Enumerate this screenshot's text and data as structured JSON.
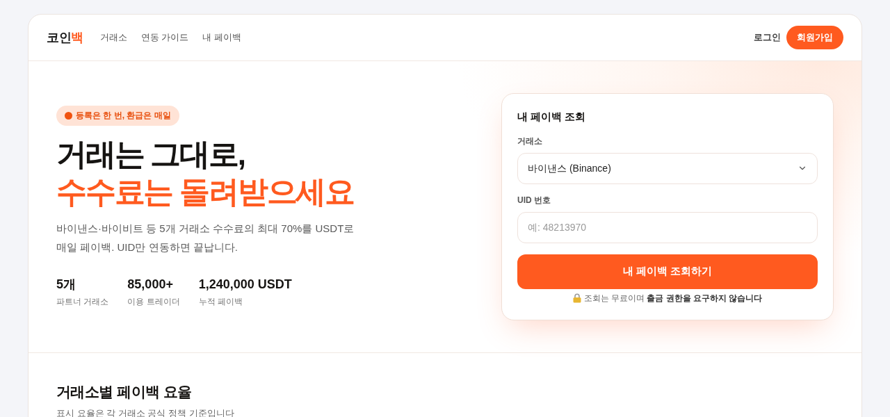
{
  "header": {
    "logo": {
      "text": "코인",
      "accent": "백"
    },
    "nav": [
      "거래소",
      "연동 가이드",
      "내 페이백"
    ],
    "login": "로그인",
    "signup": "회원가입"
  },
  "hero": {
    "badge": "등록은 한 번, 환급은 매일",
    "headline": [
      {
        "text": "거래는 그대로,",
        "highlighted": false
      },
      {
        "text": "수수료는 돌려받으세요",
        "highlighted": true
      }
    ],
    "description": "바이낸스·바이비트 등 5개 거래소 수수료의 최대 70%를 USDT로 매일 페이백. UID만 연동하면 끝납니다.",
    "stats": [
      {
        "value": "5개",
        "label": "파트너 거래소"
      },
      {
        "value": "85,000+",
        "label": "이용 트레이더"
      },
      {
        "value": "1,240,000 USDT",
        "label": "누적 페이백"
      }
    ]
  },
  "lookup_form": {
    "title": "내 페이백 조회",
    "exchange": {
      "label": "거래소",
      "value": "바이낸스 (Binance)"
    },
    "uid": {
      "label": "UID 번호",
      "placeholder": "예: 48213970"
    },
    "submit": "내 페이백 조회하기",
    "note": "조회는 무료이며 **출금 권한을 요구하지 않습니다**"
  },
  "rates_section": {
    "title": "거래소별 페이백 요율",
    "subtitle": "표시 요율은 각 거래소 공식 정책 기준입니다"
  }
}
